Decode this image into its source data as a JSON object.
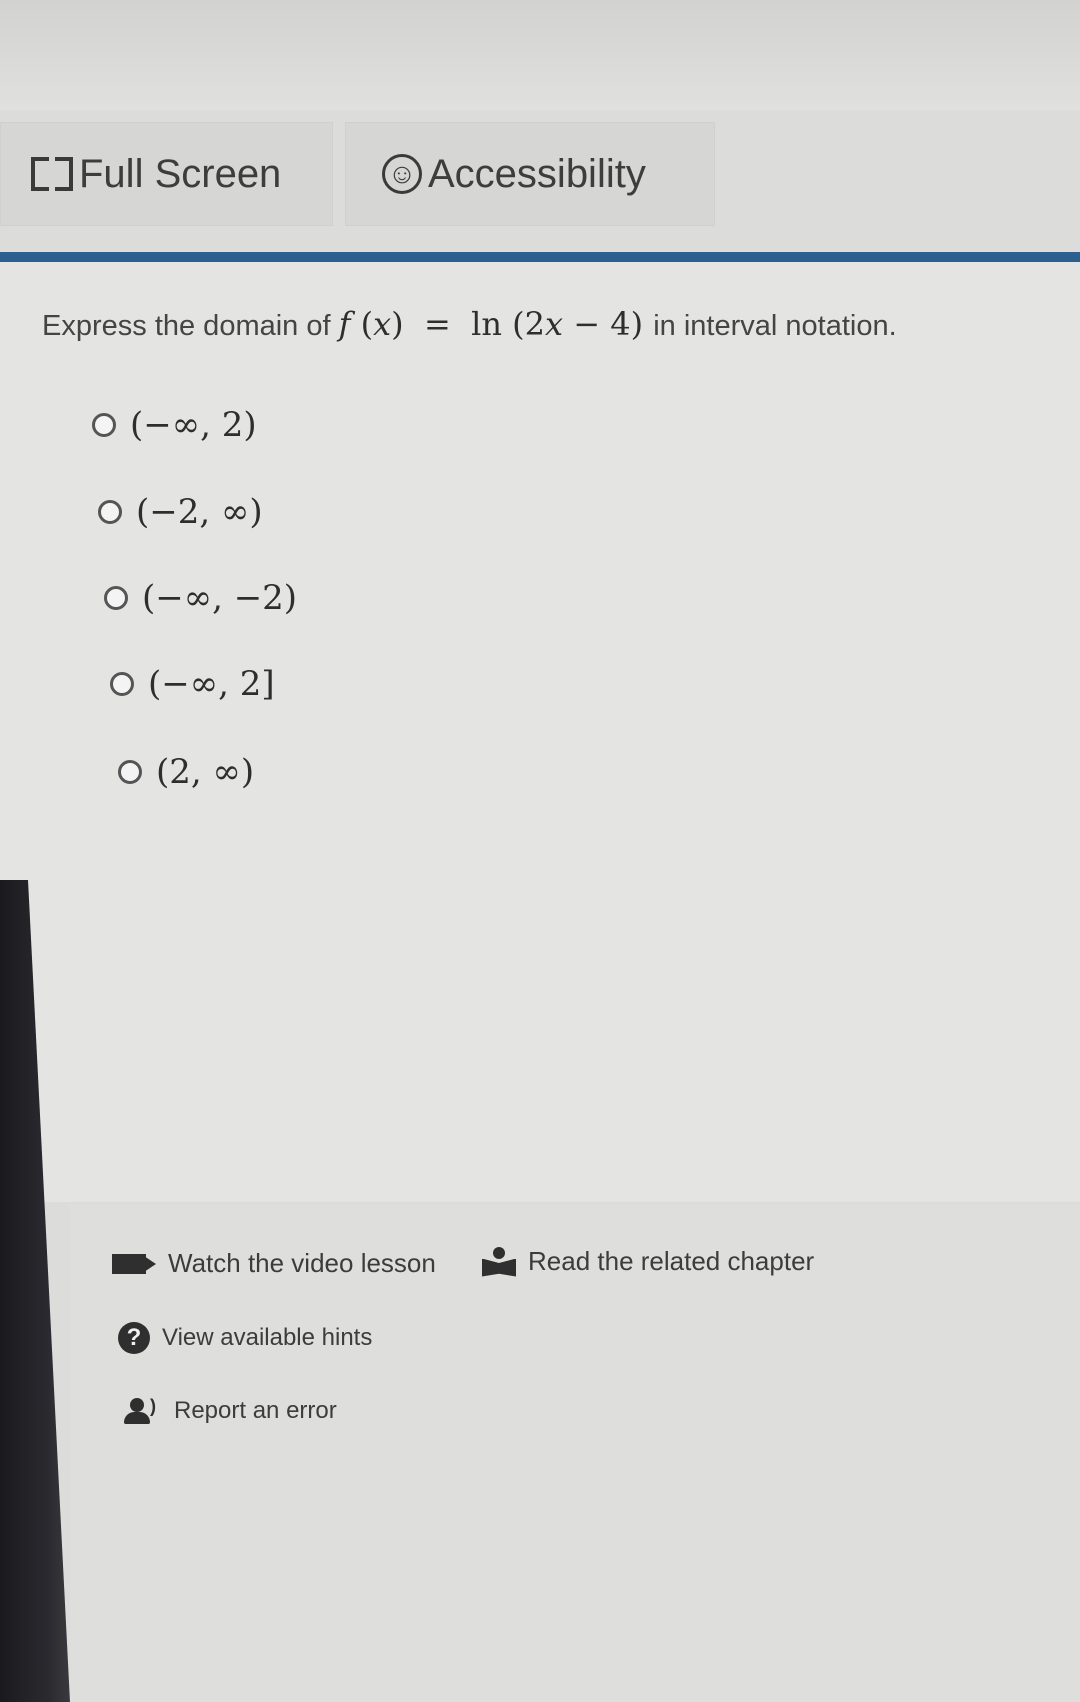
{
  "toolbar": {
    "fullscreen_label": "Full Screen",
    "accessibility_label": "Accessibility"
  },
  "question": {
    "prefix": "Express the domain of",
    "fx": "f",
    "x": "x",
    "equals": "=",
    "ln": "ln",
    "arg_open": "(2",
    "arg_x": "x",
    "minus": "−",
    "arg_close": "4)",
    "suffix": "in interval notation."
  },
  "options": [
    {
      "label": "(−∞, 2)"
    },
    {
      "label": "(−2, ∞)"
    },
    {
      "label": "(−∞, −2)"
    },
    {
      "label": "(−∞, 2]"
    },
    {
      "label": "(2, ∞)"
    }
  ],
  "links": {
    "video": "Watch the video lesson",
    "chapter": "Read the related chapter",
    "hints": "View available hints",
    "report": "Report an error"
  },
  "colors": {
    "accent_rule": "#2b5f8f"
  }
}
